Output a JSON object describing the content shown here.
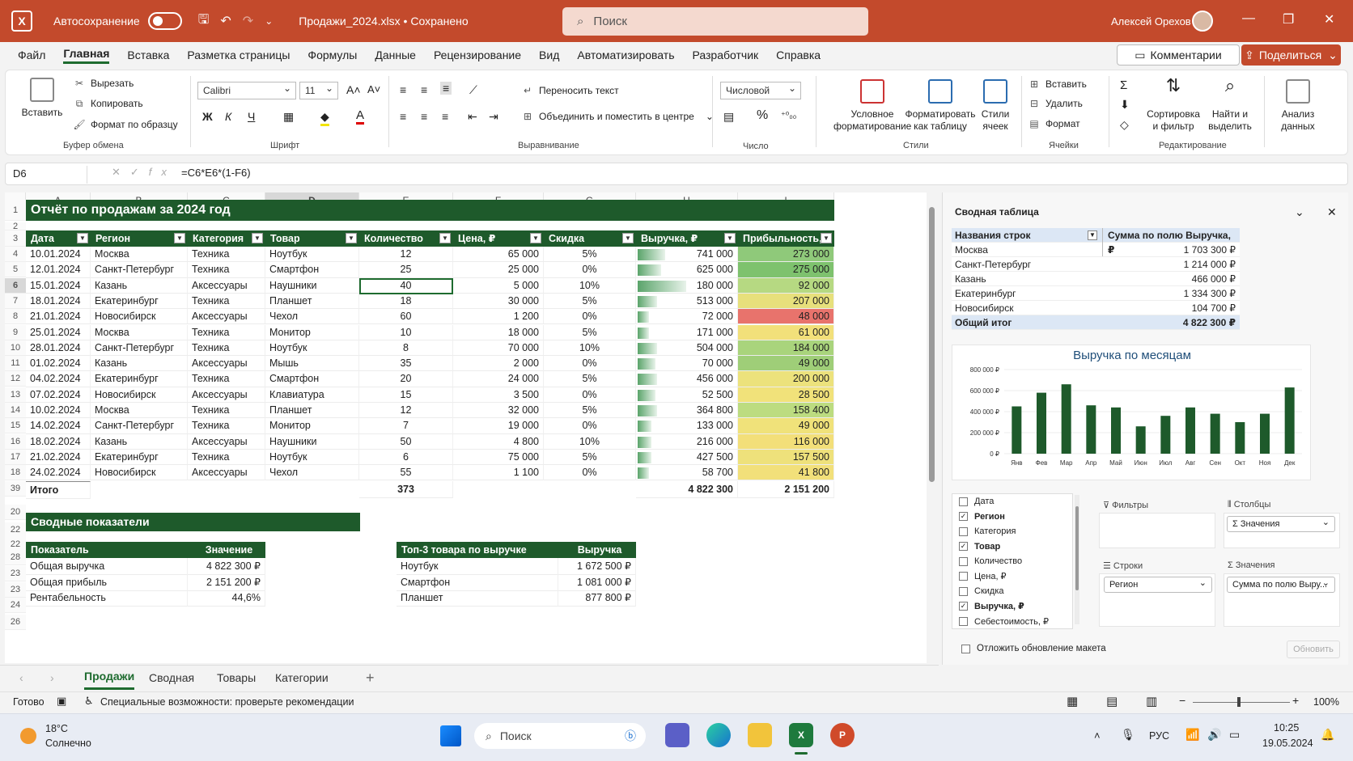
{
  "titlebar": {
    "autosave_label": "Автосохранение",
    "doc_title": "Продажи_2024.xlsx • Сохранено",
    "search_placeholder": "Поиск",
    "user_name": "Алексей Орехов"
  },
  "menu": {
    "items": [
      "Файл",
      "Главная",
      "Вставка",
      "Разметка страницы",
      "Формулы",
      "Данные",
      "Рецензирование",
      "Вид",
      "Автоматизировать",
      "Разработчик",
      "Справка"
    ],
    "active": "Главная",
    "comments_label": "Комментарии",
    "share_label": "Поделиться"
  },
  "ribbon": {
    "clipboard": {
      "paste": "Вставить",
      "cut": "Вырезать",
      "copy": "Копировать",
      "format_painter": "Формат по образцу",
      "group": "Буфер обмена"
    },
    "font": {
      "family": "Calibri",
      "size": "11",
      "bold": "Ж",
      "italic": "К",
      "underline": "Ч",
      "group": "Шрифт"
    },
    "alignment": {
      "wrap": "Переносить текст",
      "merge": "Объединить и поместить в центре",
      "group": "Выравнивание"
    },
    "number": {
      "format": "Числовой",
      "percent": "%",
      "group": "Число"
    },
    "styles": {
      "conditional": "Условное форматирование",
      "format_table": "Форматировать как таблицу",
      "cell_styles": "Стили ячеек",
      "group": "Стили"
    },
    "cells": {
      "insert": "Вставить",
      "delete": "Удалить",
      "format": "Формат",
      "group": "Ячейки"
    },
    "editing": {
      "sort": "Сортировка и фильтр",
      "find": "Найти и выделить",
      "group": "Редактирование"
    },
    "analysis": {
      "label": "Анализ данных"
    }
  },
  "formula_bar": {
    "name_box": "D6",
    "formula": "=C6*E6*(1-F6)"
  },
  "sheet": {
    "columns": [
      "A",
      "B",
      "C",
      "D",
      "E",
      "F",
      "G",
      "H",
      "I"
    ],
    "title": "Отчёт по продажам за 2024 год",
    "headers": [
      "Дата",
      "Регион",
      "Категория",
      "Товар",
      "Количество",
      "Цена, ₽",
      "Скидка",
      "Выручка, ₽",
      "Прибыльность, ₽"
    ],
    "rows": [
      {
        "rn": "4",
        "date": "10.01.2024",
        "region": "Москва",
        "cat": "Техника",
        "item": "Ноутбук",
        "qty": "12",
        "price": "65 000",
        "disc": "5%",
        "rev": "741 000",
        "profit": "273 000",
        "bar": 0.28,
        "heat": "#8fc97a"
      },
      {
        "rn": "5",
        "date": "12.01.2024",
        "region": "Санкт-Петербург",
        "cat": "Техника",
        "item": "Смартфон",
        "qty": "25",
        "price": "25 000",
        "disc": "0%",
        "rev": "625 000",
        "profit": "275 000",
        "bar": 0.24,
        "heat": "#7ec26e"
      },
      {
        "rn": "6",
        "date": "15.01.2024",
        "region": "Казань",
        "cat": "Аксессуары",
        "item": "Наушники",
        "qty": "40",
        "price": "5 000",
        "disc": "10%",
        "rev": "180 000",
        "profit": "92 000",
        "bar": 0.5,
        "heat": "#b6d982"
      },
      {
        "rn": "7",
        "date": "18.01.2024",
        "region": "Екатеринбург",
        "cat": "Техника",
        "item": "Планшет",
        "qty": "18",
        "price": "30 000",
        "disc": "5%",
        "rev": "513 000",
        "profit": "207 000",
        "bar": 0.2,
        "heat": "#e7e07c"
      },
      {
        "rn": "8",
        "date": "21.01.2024",
        "region": "Новосибирск",
        "cat": "Аксессуары",
        "item": "Чехол",
        "qty": "60",
        "price": "1 200",
        "disc": "0%",
        "rev": "72 000",
        "profit": "48 000",
        "bar": 0.12,
        "heat": "#e8736c"
      },
      {
        "rn": "9",
        "date": "25.01.2024",
        "region": "Москва",
        "cat": "Техника",
        "item": "Монитор",
        "qty": "10",
        "price": "18 000",
        "disc": "5%",
        "rev": "171 000",
        "profit": "61 000",
        "bar": 0.12,
        "heat": "#f2e07a"
      },
      {
        "rn": "10",
        "date": "28.01.2024",
        "region": "Санкт-Петербург",
        "cat": "Техника",
        "item": "Ноутбук",
        "qty": "8",
        "price": "70 000",
        "disc": "10%",
        "rev": "504 000",
        "profit": "184 000",
        "bar": 0.2,
        "heat": "#a9d47c"
      },
      {
        "rn": "11",
        "date": "01.02.2024",
        "region": "Казань",
        "cat": "Аксессуары",
        "item": "Мышь",
        "qty": "35",
        "price": "2 000",
        "disc": "0%",
        "rev": "70 000",
        "profit": "49 000",
        "bar": 0.18,
        "heat": "#9fce78"
      },
      {
        "rn": "12",
        "date": "04.02.2024",
        "region": "Екатеринбург",
        "cat": "Техника",
        "item": "Смартфон",
        "qty": "20",
        "price": "24 000",
        "disc": "5%",
        "rev": "456 000",
        "profit": "200 000",
        "bar": 0.2,
        "heat": "#ece27c"
      },
      {
        "rn": "13",
        "date": "07.02.2024",
        "region": "Новосибирск",
        "cat": "Аксессуары",
        "item": "Клавиатура",
        "qty": "15",
        "price": "3 500",
        "disc": "0%",
        "rev": "52 500",
        "profit": "28 500",
        "bar": 0.18,
        "heat": "#f1e27a"
      },
      {
        "rn": "14",
        "date": "10.02.2024",
        "region": "Москва",
        "cat": "Техника",
        "item": "Планшет",
        "qty": "12",
        "price": "32 000",
        "disc": "5%",
        "rev": "364 800",
        "profit": "158 400",
        "bar": 0.2,
        "heat": "#bcdc80"
      },
      {
        "rn": "15",
        "date": "14.02.2024",
        "region": "Санкт-Петербург",
        "cat": "Техника",
        "item": "Монитор",
        "qty": "7",
        "price": "19 000",
        "disc": "0%",
        "rev": "133 000",
        "profit": "49 000",
        "bar": 0.14,
        "heat": "#f0e27a"
      },
      {
        "rn": "16",
        "date": "18.02.2024",
        "region": "Казань",
        "cat": "Аксессуары",
        "item": "Наушники",
        "qty": "50",
        "price": "4 800",
        "disc": "10%",
        "rev": "216 000",
        "profit": "116 000",
        "bar": 0.14,
        "heat": "#f3df79"
      },
      {
        "rn": "17",
        "date": "21.02.2024",
        "region": "Екатеринбург",
        "cat": "Техника",
        "item": "Ноутбук",
        "qty": "6",
        "price": "75 000",
        "disc": "5%",
        "rev": "427 500",
        "profit": "157 500",
        "bar": 0.14,
        "heat": "#eee17b"
      },
      {
        "rn": "18",
        "date": "24.02.2024",
        "region": "Новосибирск",
        "cat": "Аксессуары",
        "item": "Чехол",
        "qty": "55",
        "price": "1 100",
        "disc": "0%",
        "rev": "58 700",
        "profit": "41 800",
        "bar": 0.12,
        "heat": "#f2e07a"
      }
    ],
    "total": {
      "rn": "39",
      "label": "Итого",
      "qty": "373",
      "rev": "4 822 300",
      "profit": "2 151 200"
    },
    "row_numbers_extra": [
      "1",
      "2",
      "3",
      "20",
      "22",
      "22",
      "28",
      "23",
      "23",
      "24",
      "26"
    ],
    "summary": {
      "band": "Сводные показатели",
      "h1": "Показатель",
      "h2": "Значение",
      "rows": [
        [
          "Общая выручка",
          "4 822 300 ₽"
        ],
        [
          "Общая прибыль",
          "2 151 200 ₽"
        ],
        [
          "Рентабельность",
          "44,6%"
        ]
      ]
    },
    "top3": {
      "h1": "Топ-3 товара по выручке",
      "h2": "Выручка",
      "rows": [
        [
          "Ноутбук",
          "1 672 500 ₽"
        ],
        [
          "Смартфон",
          "1 081 000 ₽"
        ],
        [
          "Планшет",
          "877 800 ₽"
        ]
      ]
    }
  },
  "tabs": {
    "items": [
      "Продажи",
      "Сводная",
      "Товары",
      "Категории"
    ],
    "active": "Продажи",
    "add": "+"
  },
  "status": {
    "ready": "Готово",
    "accessibility": "Специальные возможности: проверьте рекомендации",
    "zoom": "100%"
  },
  "pivot": {
    "title": "Сводная таблица",
    "col1": "Названия строк",
    "col2": "Сумма по полю Выручка, ₽",
    "rows": [
      [
        "Москва",
        "1 703 300 ₽"
      ],
      [
        "Санкт-Петербург",
        "1 214 000 ₽"
      ],
      [
        "Казань",
        "466 000 ₽"
      ],
      [
        "Екатеринбург",
        "1 334 300 ₽"
      ],
      [
        "Новосибирск",
        "104 700 ₽"
      ]
    ],
    "total": [
      "Общий итог",
      "4 822 300 ₽"
    ],
    "fields": [
      {
        "name": "Дата",
        "checked": false
      },
      {
        "name": "Регион",
        "checked": true
      },
      {
        "name": "Категория",
        "checked": false
      },
      {
        "name": "Товар",
        "checked": true
      },
      {
        "name": "Количество",
        "checked": false
      },
      {
        "name": "Цена, ₽",
        "checked": false
      },
      {
        "name": "Скидка",
        "checked": false
      },
      {
        "name": "Выручка, ₽",
        "checked": true
      },
      {
        "name": "Себестоимость, ₽",
        "checked": false
      }
    ],
    "filters_label": "Фильтры",
    "columns_label": "Столбцы",
    "columns_value": "Σ  Значения",
    "rows_label": "Строки",
    "rows_value": "Регион",
    "values_label": "Значения",
    "values_value": "Сумма по полю Выру...",
    "defer_label": "Отложить обновление макета",
    "update_label": "Обновить"
  },
  "chart_data": {
    "type": "bar",
    "title": "Выручка по месяцам",
    "categories": [
      "Янв",
      "Фев",
      "Мар",
      "Апр",
      "Май",
      "Июн",
      "Июл",
      "Авг",
      "Сен",
      "Окт",
      "Ноя",
      "Дек"
    ],
    "values": [
      450000,
      580000,
      660000,
      460000,
      440000,
      260000,
      360000,
      440000,
      380000,
      300000,
      380000,
      630000
    ],
    "yticks": [
      "0 ₽",
      "200 000 ₽",
      "400 000 ₽",
      "600 000 ₽",
      "800 000 ₽"
    ],
    "ylim": [
      0,
      800000
    ],
    "color": "#1e5a2b"
  },
  "taskbar": {
    "weather_temp": "18°C",
    "weather_desc": "Солнечно",
    "search": "Поиск",
    "lang": "РУС",
    "time": "10:25",
    "date": "19.05.2024"
  }
}
